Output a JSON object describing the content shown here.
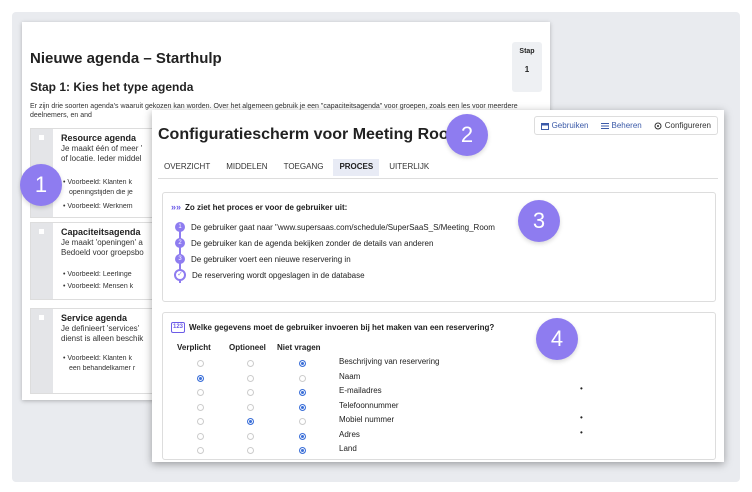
{
  "starthulp": {
    "title": "Nieuwe agenda – Starthulp",
    "subtitle": "Stap 1: Kies het type agenda",
    "intro": "Er zijn drie soorten agenda's waaruit gekozen kan worden. Over het algemeen gebruik je een \"capaciteitsagenda\" voor groepen, zoals een les voor meerdere deelnemers, en and",
    "stap_label": "Stap",
    "stap_value": "1",
    "types": [
      {
        "name": "Resource agenda",
        "desc1": "Je maakt één of meer '",
        "desc2": "of locatie. Ieder middel",
        "ex1": "• Voorbeeld: Klanten k",
        "ex1b": "openingstijden die je",
        "ex2": "• Voorbeeld: Werknem"
      },
      {
        "name": "Capaciteitsagenda",
        "desc1": "Je maakt 'openingen' a",
        "desc2": "Bedoeld voor groepsbo",
        "ex1": "• Voorbeeld: Leerlinge",
        "ex2": "• Voorbeeld: Mensen k"
      },
      {
        "name": "Service agenda",
        "desc1": "Je definieert 'services'",
        "desc2": "dienst is alleen beschik",
        "ex1": "• Voorbeeld: Klanten k",
        "ex1b": "een behandelkamer r"
      }
    ]
  },
  "badges": [
    "1",
    "2",
    "3",
    "4"
  ],
  "config": {
    "title": "Configuratiescherm voor Meeting Room",
    "actions": [
      {
        "label": "Gebruiken",
        "icon": "calendar-icon"
      },
      {
        "label": "Beheren",
        "icon": "list-icon"
      },
      {
        "label": "Configureren",
        "icon": "gear-icon"
      }
    ],
    "tabs": [
      "OVERZICHT",
      "MIDDELEN",
      "TOEGANG",
      "PROCES",
      "UITERLIJK"
    ],
    "active_tab": "PROCES",
    "process": {
      "heading": "Zo ziet het proces er voor de gebruiker uit:",
      "steps": [
        "De gebruiker gaat naar \"www.supersaas.com/schedule/SuperSaaS_S/Meeting_Room",
        "De gebruiker kan de agenda bekijken zonder de details van anderen",
        "De gebruiker voert een nieuwe reservering in",
        "De reservering wordt opgeslagen in de database"
      ],
      "step_numbers": [
        "1",
        "2",
        "3"
      ]
    },
    "fields_panel": {
      "heading": "Welke gegevens moet de gebruiker invoeren bij het maken van een reservering?",
      "icon_text": "123",
      "columns": [
        "Verplicht",
        "Optioneel",
        "Niet vragen"
      ],
      "rows": [
        {
          "label": "Beschrijving van reservering",
          "choice": 2,
          "star": ""
        },
        {
          "label": "Naam",
          "choice": 0,
          "star": ""
        },
        {
          "label": "E-mailadres",
          "choice": 2,
          "star": "•"
        },
        {
          "label": "Telefoonnummer",
          "choice": 2,
          "star": ""
        },
        {
          "label": "Mobiel nummer",
          "choice": 1,
          "star": "•"
        },
        {
          "label": "Adres",
          "choice": 2,
          "star": "•"
        },
        {
          "label": "Land",
          "choice": 2,
          "star": ""
        }
      ]
    }
  },
  "colors": {
    "accent": "#8e7cf0",
    "link": "#3b5aa8",
    "radio_on": "#3b6fd8"
  }
}
